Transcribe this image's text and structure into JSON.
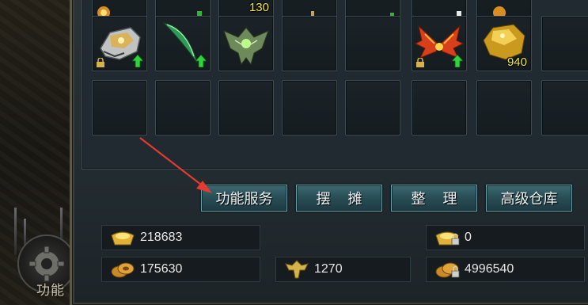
{
  "inventory": {
    "row1_partial": [
      {
        "icon": "fire-item-icon",
        "qty": ""
      },
      {
        "icon": "item-icon",
        "qty": ""
      },
      {
        "icon": "item-icon",
        "qty": "130"
      },
      {
        "icon": "item-icon",
        "qty": ""
      },
      {
        "icon": "item-icon",
        "qty": ""
      },
      {
        "icon": "item-icon",
        "qty": ""
      },
      {
        "icon": "item-icon",
        "qty": ""
      }
    ],
    "row2": [
      {
        "icon": "mech-armor-icon",
        "locked": true,
        "upgrade": true,
        "qty": ""
      },
      {
        "icon": "green-blade-icon",
        "locked": false,
        "upgrade": true,
        "qty": ""
      },
      {
        "icon": "winged-helm-icon",
        "locked": false,
        "upgrade": false,
        "qty": ""
      },
      {
        "icon": "",
        "qty": ""
      },
      {
        "icon": "",
        "qty": ""
      },
      {
        "icon": "fire-wings-icon",
        "locked": true,
        "upgrade": true,
        "qty": ""
      },
      {
        "icon": "gold-ore-icon",
        "locked": false,
        "upgrade": false,
        "qty": "940"
      },
      {
        "icon": "",
        "qty": ""
      }
    ]
  },
  "buttons": {
    "function_service": "功能服务",
    "stall": "摆摊",
    "arrange": "整理",
    "advanced_warehouse": "高级仓库"
  },
  "currency": {
    "gold_ingot": "218683",
    "locked_ingot": "0",
    "coins": "175630",
    "trophy": "1270",
    "locked_coins": "4996540"
  },
  "side": {
    "function_label": "功能"
  },
  "colors": {
    "button_border": "#6da2ab",
    "quantity_text": "#f2e74a",
    "annotation_arrow": "#e43a2f"
  }
}
